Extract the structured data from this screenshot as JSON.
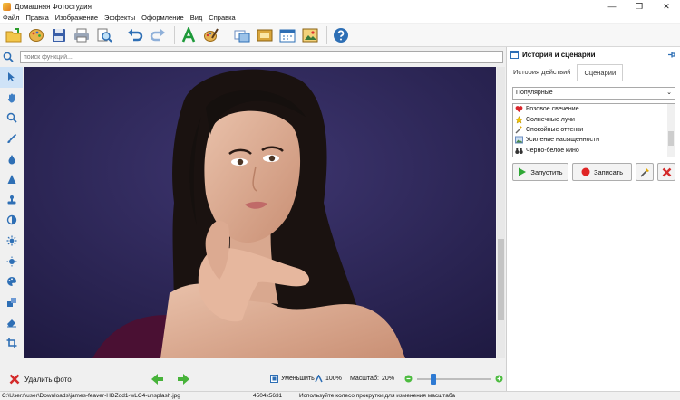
{
  "window": {
    "title": "Домашняя Фотостудия",
    "minimize": "—",
    "restore": "❐",
    "close": "✕"
  },
  "menu": [
    "Файл",
    "Правка",
    "Изображение",
    "Эффекты",
    "Оформление",
    "Вид",
    "Справка"
  ],
  "search": {
    "placeholder": "поиск функций..."
  },
  "right_panel": {
    "title": "История и сценарии",
    "tabs": [
      "История действий",
      "Сценарии"
    ],
    "active_tab": "Сценарии",
    "preset_selected": "Популярные",
    "scenarios": [
      {
        "label": "Розовое свечение",
        "icon": "heart-icon",
        "color": "#d9262b"
      },
      {
        "label": "Солнечные лучи",
        "icon": "star-icon",
        "color": "#f2c200"
      },
      {
        "label": "Спокойные оттенки",
        "icon": "wand-icon",
        "color": "#8a8a8a"
      },
      {
        "label": "Усиление насыщенности",
        "icon": "image-icon",
        "color": "#6b8ec2"
      },
      {
        "label": "Черно-белое кино",
        "icon": "binoculars-icon",
        "color": "#333333"
      }
    ],
    "run_label": "Запустить",
    "record_label": "Записать"
  },
  "bottom": {
    "delete_label": "Удалить фото",
    "shrink_label": "Уменьшить",
    "zoom_100": "100%",
    "scale_label": "Масштаб:",
    "scale_value": "20%",
    "scale_fraction": 0.2
  },
  "status": {
    "path": "C:\\Users\\user\\Downloads\\james-feaver-HDZod1-wLC4-unsplash.jpg",
    "dimensions": "4504x5631",
    "hint": "Используйте колесо прокрутки для изменения масштаба"
  },
  "colors": {
    "accent": "#1a73c8",
    "canvas_bg": "#2a2350"
  }
}
